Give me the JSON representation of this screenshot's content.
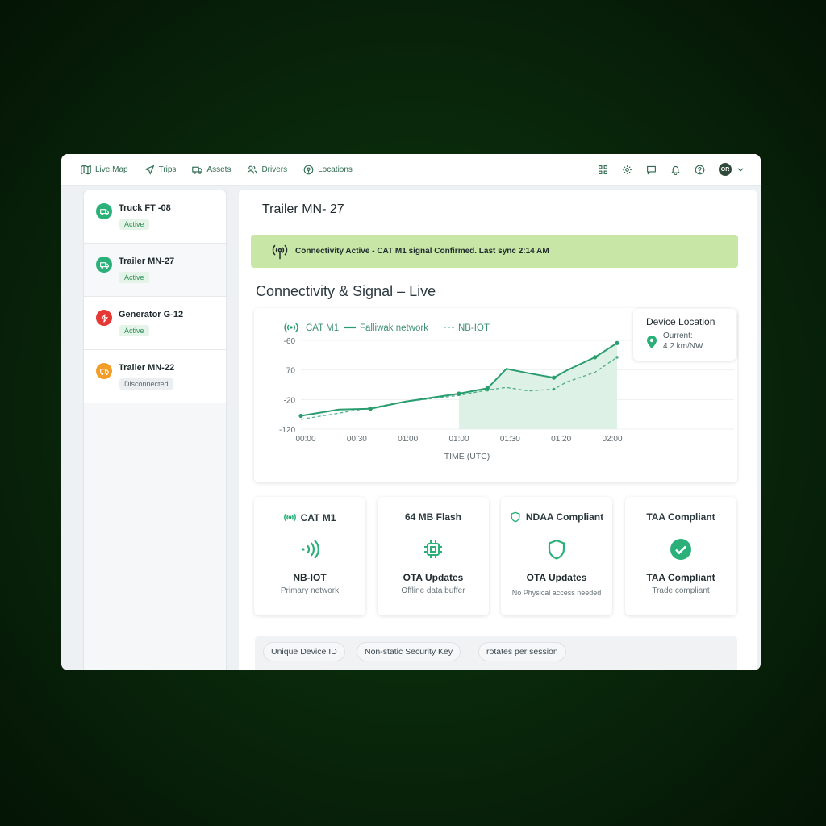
{
  "nav": {
    "items": [
      {
        "label": "Live Map",
        "icon": "map-icon"
      },
      {
        "label": "Trips",
        "icon": "navigation-icon"
      },
      {
        "label": "Assets",
        "icon": "truck-icon"
      },
      {
        "label": "Drivers",
        "icon": "users-icon"
      },
      {
        "label": "Locations",
        "icon": "location-pin-icon"
      }
    ],
    "right_icons": [
      "grid-icon",
      "gear-icon",
      "chat-icon",
      "bell-icon",
      "help-icon"
    ],
    "avatar_initials": "OR"
  },
  "sidebar": {
    "assets": [
      {
        "name": "Truck FT -08",
        "status": "Active",
        "icon": "truck-icon",
        "color": "#2bb07a"
      },
      {
        "name": "Trailer MN-27",
        "status": "Active",
        "icon": "truck-icon",
        "color": "#2bb07a"
      },
      {
        "name": "Generator G-12",
        "status": "Active",
        "icon": "bolt-icon",
        "color": "#e53935"
      },
      {
        "name": "Trailer MN-22",
        "status": "Disconnected",
        "icon": "truck-icon",
        "color": "#f29d28"
      }
    ]
  },
  "main": {
    "title": "Trailer MN- 27",
    "banner": "Connectivity Active - CAT M1 signal Confirmed. Last sync 2:14 AM",
    "section_title": "Connectivity & Signal – Live",
    "device_location": {
      "title": "Device Location",
      "line1": "Ourrent:",
      "line2": "4.2 km/NW"
    },
    "stats": [
      {
        "head": "CAT M1",
        "head_icon": "signal-icon",
        "icon": "wireless-icon",
        "label": "NB-IOT",
        "sub": "Primary network"
      },
      {
        "head": "64 MB Flash",
        "head_icon": "",
        "icon": "chip-icon",
        "label": "OTA Updates",
        "sub": "Offline data buffer"
      },
      {
        "head": "NDAA Compliant",
        "head_icon": "shield-icon",
        "icon": "shield-icon",
        "label": "OTA Updates",
        "sub": "No Physical access needed"
      },
      {
        "head": "TAA Compliant",
        "head_icon": "",
        "icon": "check-circle-icon",
        "label": "TAA Compliant",
        "sub": "Trade compliant"
      }
    ],
    "chips": [
      "Unique Device ID",
      "Non-static Security Key",
      "rotates per session"
    ]
  },
  "colors": {
    "accent": "#2bb07a",
    "banner": "#c8e6a6",
    "line": "#2a9d6f"
  },
  "chart_data": {
    "type": "line",
    "legend": [
      "CAT M1",
      "Falliwak network",
      "NB-IOT"
    ],
    "xlabel": "TIME (UTC)",
    "x_ticks": [
      "00:00",
      "00:30",
      "01:00",
      "01:00",
      "01:30",
      "01:20",
      "02:00"
    ],
    "y_ticks": [
      "-60",
      "70",
      "-20",
      "-120"
    ],
    "series": [
      {
        "name": "Falliwak network",
        "values": [
          0.15,
          0.22,
          0.23,
          0.31,
          0.4,
          0.46,
          0.68,
          0.63,
          0.58,
          0.66,
          0.81,
          0.97
        ]
      },
      {
        "name": "NB-IOT",
        "values": [
          0.11,
          0.18,
          0.24,
          0.31,
          0.38,
          0.44,
          0.47,
          0.43,
          0.45,
          0.53,
          0.64,
          0.81
        ]
      }
    ],
    "x_positions": [
      0,
      0.12,
      0.22,
      0.33,
      0.5,
      0.59,
      0.65,
      0.72,
      0.8,
      0.84,
      0.93,
      1.0
    ],
    "shaded_from": 0.5
  }
}
